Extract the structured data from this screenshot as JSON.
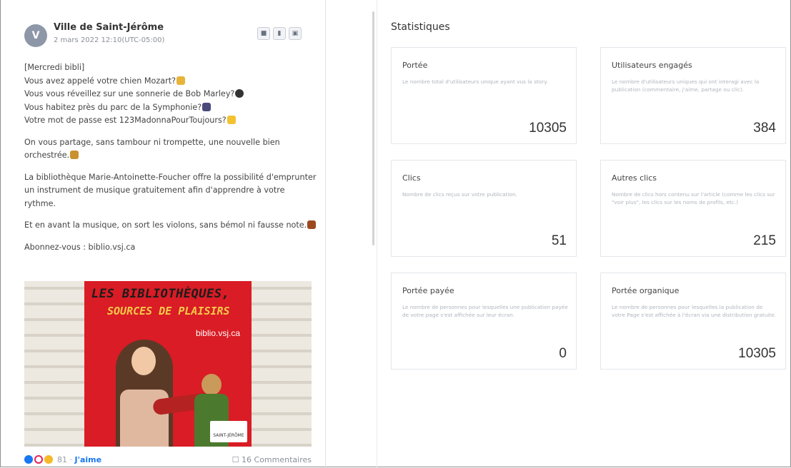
{
  "post": {
    "avatar_letter": "V",
    "author": "Ville de Saint-Jérôme",
    "date": "2 mars 2022 12:10(UTC-05:00)",
    "lines": [
      "[Mercredi bibli]",
      "Vous avez appelé votre chien Mozart?",
      "Vous vous réveillez sur une sonnerie de Bob Marley?",
      "Vous habitez près du parc de la Symphonie?",
      "Votre mot de passe est 123MadonnaPourToujours?"
    ],
    "para2": "On vous partage, sans tambour ni trompette, une nouvelle bien orchestrée.",
    "para3": "La bibliothèque Marie-Antoinette-Foucher offre la possibilité d'emprunter un instrument de musique gratuitement afin d'apprendre à votre rythme.",
    "para4": "Et en avant la musique, on sort les violons, sans bémol ni fausse note.",
    "para5": "Abonnez-vous : biblio.vsj.ca",
    "image": {
      "title_line1": "LES BIBLIOTHÈQUES,",
      "title_line2": "SOURCES DE PLAISIRS",
      "url": "biblio.vsj.ca",
      "logo_text": "SAINT-JÉRÔME"
    },
    "reactions_count": "81",
    "like_label": "J'aime",
    "comments_label": "16 Commentaires"
  },
  "stats": {
    "title": "Statistiques",
    "cards": [
      {
        "title": "Portée",
        "desc": "Le nombre total d'utilisateurs unique ayant vus la story.",
        "value": "10305"
      },
      {
        "title": "Utilisateurs engagés",
        "desc": "Le nombre d'utilisateurs uniques qui ont interagi avec la publication (commentaire, j'aime, partage ou clic).",
        "value": "384"
      },
      {
        "title": "Clics",
        "desc": "Nombre de clics reçus sur votre publication.",
        "value": "51"
      },
      {
        "title": "Autres clics",
        "desc": "Nombre de clics hors contenu sur l'article (comme les clics sur \"voir plus\", les clics sur les noms de profils, etc.)",
        "value": "215"
      },
      {
        "title": "Portée payée",
        "desc": "Le nombre de personnes pour lesquelles une publication payée de votre page s'est affichée sur leur écran.",
        "value": "0"
      },
      {
        "title": "Portée organique",
        "desc": "Le nombre de personnes pour lesquelles la publication de votre Page s'est affichée à l'écran via une distribution gratuite.",
        "value": "10305"
      }
    ]
  },
  "colors": {
    "like_blue": "#1877f2",
    "poster_red": "#d91c25",
    "poster_yellow": "#f7c948"
  }
}
